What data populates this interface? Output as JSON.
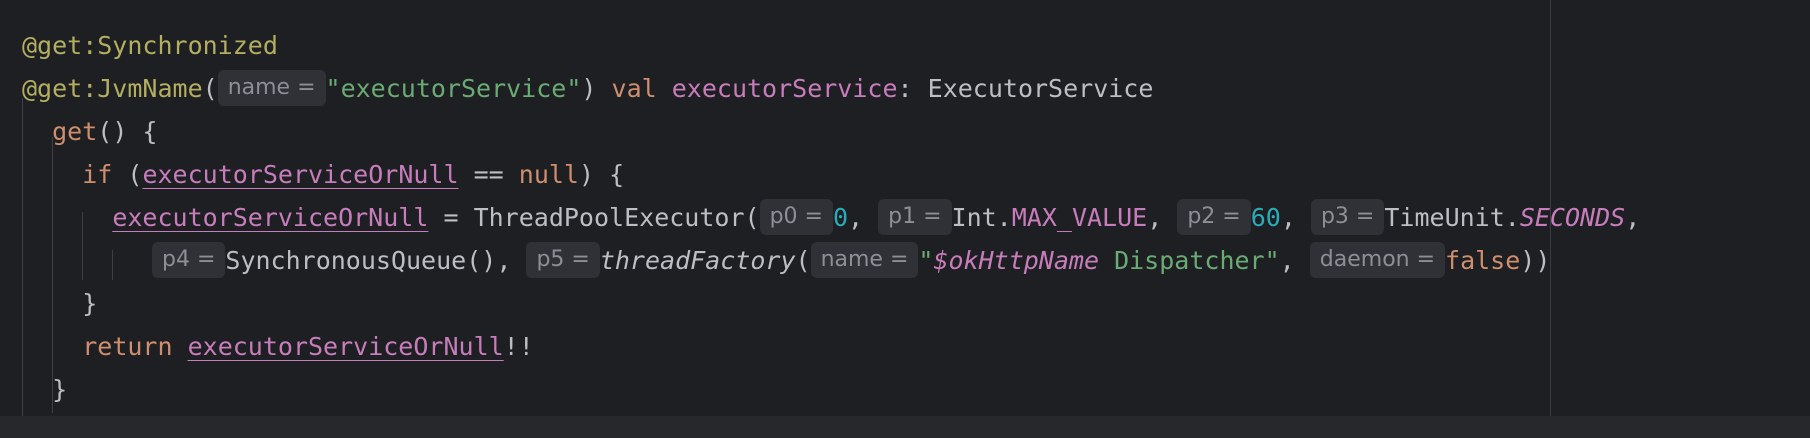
{
  "code": {
    "line1": {
      "annotation": "@get:Synchronized"
    },
    "line2": {
      "annotation": "@get:JvmName",
      "open_paren": "(",
      "hint_name": "name =",
      "string": "\"executorService\"",
      "close_paren": ")",
      "kw_val": "val",
      "property": "executorService",
      "colon": ":",
      "type": "ExecutorService"
    },
    "line3": {
      "kw_get": "get",
      "rest": "() {"
    },
    "line4": {
      "kw_if": "if",
      "open": "(",
      "property": "executorServiceOrNull",
      "op": "==",
      "kw_null": "null",
      "close": ") {"
    },
    "line5": {
      "property": "executorServiceOrNull",
      "assign": "=",
      "call": "ThreadPoolExecutor(",
      "hint_p0": "p0 =",
      "num0": "0",
      "comma1": ",",
      "hint_p1": "p1 =",
      "int_type": "Int.",
      "max_value": "MAX_VALUE",
      "comma2": ",",
      "hint_p2": "p2 =",
      "num60": "60",
      "comma3": ",",
      "hint_p3": "p3 =",
      "timeunit": "TimeUnit.",
      "seconds": "SECONDS",
      "comma4": ","
    },
    "line6": {
      "hint_p4": "p4 =",
      "queue": "SynchronousQueue(),",
      "hint_p5": "p5 =",
      "thread_factory": "threadFactory",
      "paren": "(",
      "hint_name": "name =",
      "quote_open": "\"",
      "interp": "$okHttpName",
      "str_rest": " Dispatcher\"",
      "comma": ",",
      "hint_daemon": "daemon =",
      "kw_false": "false",
      "close": "))"
    },
    "line7": {
      "brace": "}"
    },
    "line8": {
      "kw_return": "return",
      "property": "executorServiceOrNull",
      "bang": "!!"
    },
    "line9": {
      "brace": "}"
    }
  }
}
